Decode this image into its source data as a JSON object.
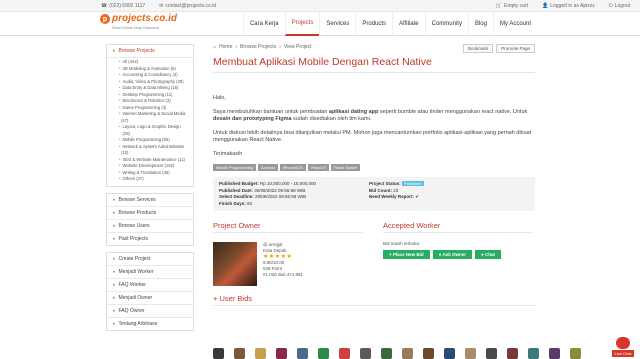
{
  "topbar": {
    "phone": "(022) 6902 1117",
    "email": "contact@projects.co.id",
    "cart": "Empty cart",
    "logged": "Logged in as Apizzz",
    "logout": "Logout"
  },
  "brand": {
    "name": "projects.co.id",
    "tagline": "Solusi Online Kerja Outsource"
  },
  "nav": [
    "Cara Kerja",
    "Projects",
    "Services",
    "Products",
    "Affiliate",
    "Community",
    "Blog",
    "My Account"
  ],
  "sidebar": {
    "browse_projects": "Browse Projects",
    "categories": [
      "All (442)",
      "3D Modeling & Animation (6)",
      "Accounting & Consultancy (3)",
      "Audio, Video & Photography (28)",
      "Data Entry & Data Mining (15)",
      "Desktop Programming (11)",
      "Electronics & Robotics (3)",
      "Game Programming (3)",
      "Internet Marketing & Social Media",
      "(47)",
      "Layout, Logo & Graphic Design (28)",
      "Mobile Programming (55)",
      "Network & System Administration",
      "(10)",
      "SEO & Website Maintenance (11)",
      "Website Development (152)",
      "Writing & Translation (45)",
      "Others (27)"
    ],
    "links1": [
      "Browse Services",
      "Browse Products",
      "Browse Users",
      "Past Projects"
    ],
    "links2": [
      "Create Project",
      "Menjadi Worker",
      "FAQ Worker",
      "Menjadi Owner",
      "FAQ Owner",
      "Tentang Arbitrase"
    ]
  },
  "breadcrumb": [
    "Home",
    "Browse Projects",
    "View Project"
  ],
  "actions": {
    "bookmark": "Bookmark",
    "promote": "Promote Page"
  },
  "project": {
    "title": "Membuat Aplikasi Mobile Dengan React Native",
    "greeting": "Halo,",
    "para1_a": "Saya membutuhkan bantuan untuk pembuatan ",
    "para1_b": "aplikasi dating app",
    "para1_c": " seperti bumble atau tinder menggunakan react native. Untuk ",
    "para1_d": "desain dan prototyping Figma",
    "para1_e": " sudah disediakan oleh tim kami.",
    "para2": "Untuk diskusi lebih detailnya bisa dilanjutkan melalui PM. Mohon juga mencantumkan portfolio aplikasi-aplikasi yang pernah dibuat menggunakan React Native.",
    "thanks": "Terimakasih",
    "tags": [
      "Mobile Programming",
      "Android",
      "iPhone/iOS",
      "ReactJS",
      "React Native"
    ],
    "info": {
      "budget_l": "Published Budget:",
      "budget_v": "Rp 10,000,000 - 15,000,000",
      "date_l": "Published Date:",
      "date_v": "30/08/2022 09:56:58 WIB",
      "deadline_l": "Select Deadline:",
      "deadline_v": "29/09/2022 09:56:58 WIB",
      "finish_l": "Finish Days:",
      "finish_v": "60",
      "status_l": "Project Status:",
      "status_v": "Published",
      "bid_l": "Bid Count:",
      "bid_v": "23",
      "report_l": "Need Weekly Report:",
      "report_v": "✔"
    }
  },
  "owner": {
    "heading": "Project Owner",
    "user": "@ arrejjal",
    "city": "Kota Depok",
    "rating": "★★★★★",
    "score": "9.85/10.00",
    "points": "528 Point",
    "rank": "#1,020 dari 471,981"
  },
  "worker": {
    "heading": "Accepted Worker",
    "note": "Bid masih terbuka.",
    "place_bid": "Place New Bid",
    "ask_owner": "Ask Owner",
    "chat": "Chat"
  },
  "bids": {
    "heading": "User Bids"
  },
  "livechat": "Live Chat",
  "colors": {
    "accent": "#c0392b",
    "green": "#27ae60",
    "status": "#5bc0de"
  }
}
